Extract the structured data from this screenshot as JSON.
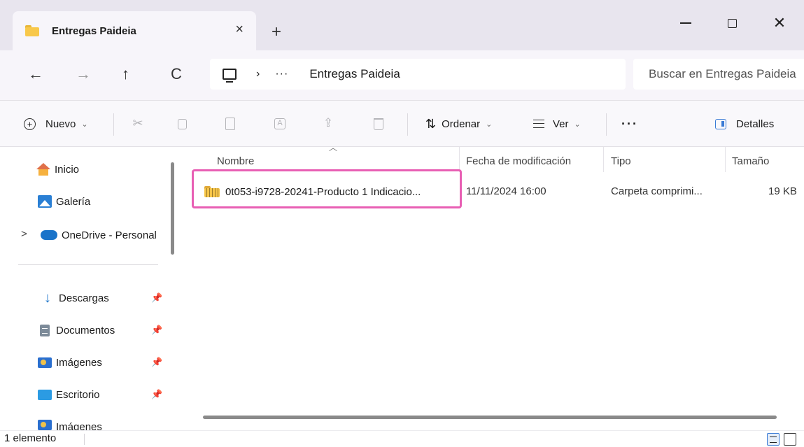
{
  "window": {
    "tab_title": "Entregas Paideia",
    "tab_close": "×",
    "tab_add": "+",
    "close_glyph": "✕"
  },
  "address": {
    "back": "←",
    "forward": "→",
    "up": "↑",
    "refresh": "C",
    "chevron": "›",
    "ellipsis": "···",
    "current_folder": "Entregas Paideia",
    "search_placeholder": "Buscar en Entregas Paideia"
  },
  "commands": {
    "new_label": "Nuevo",
    "sort_label": "Ordenar",
    "view_label": "Ver",
    "more_label": "···",
    "details_label": "Detalles",
    "caret": "⌄",
    "sort_arrows": "⇅",
    "cut_glyph": "✂",
    "share_glyph": "⇪"
  },
  "navigation": {
    "items": [
      {
        "label": "Inicio",
        "icon": "home-icon"
      },
      {
        "label": "Galería",
        "icon": "gallery-icon"
      },
      {
        "label": "OneDrive - Personal",
        "icon": "onedrive-icon"
      },
      {
        "label": "Descargas",
        "icon": "download-icon",
        "pinned": true
      },
      {
        "label": "Documentos",
        "icon": "documents-icon",
        "pinned": true
      },
      {
        "label": "Imágenes",
        "icon": "images-icon",
        "pinned": true
      },
      {
        "label": "Escritorio",
        "icon": "desktop-icon",
        "pinned": true
      },
      {
        "label": "Imágenes",
        "icon": "images-icon",
        "pinned": true
      }
    ],
    "expand_glyph": ">",
    "pin_glyph": "📌"
  },
  "filelist": {
    "columns": [
      "Nombre",
      "Fecha de modificación",
      "Tipo",
      "Tamaño"
    ],
    "sort_indicator": "︿",
    "rows": [
      {
        "name": "0t053-i9728-20241-Producto 1 Indicacio...",
        "modified": "11/11/2024 16:00",
        "type": "Carpeta comprimi...",
        "size": "19 KB",
        "icon": "zip-folder-icon"
      }
    ]
  },
  "status": {
    "item_count": "1 elemento"
  },
  "colors": {
    "accent": "#3a7bd5",
    "highlight": "#e85fb4",
    "folder": "#f8c84a"
  }
}
